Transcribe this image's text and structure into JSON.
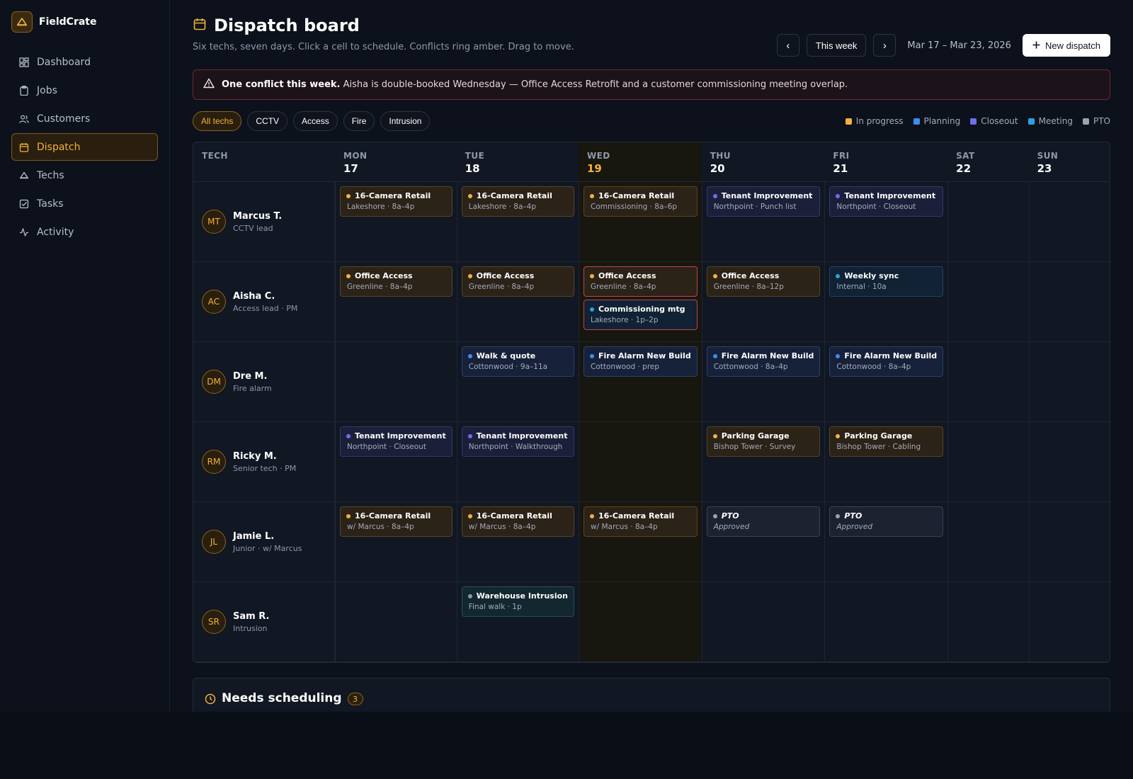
{
  "brand": {
    "name": "FieldCrate"
  },
  "nav": [
    {
      "label": "Dashboard",
      "icon": "dashboard-icon",
      "active": false
    },
    {
      "label": "Jobs",
      "icon": "clipboard-icon",
      "active": false
    },
    {
      "label": "Customers",
      "icon": "users-icon",
      "active": false
    },
    {
      "label": "Dispatch",
      "icon": "calendar-icon",
      "active": true
    },
    {
      "label": "Techs",
      "icon": "hardhat-icon",
      "active": false
    },
    {
      "label": "Tasks",
      "icon": "checkbox-icon",
      "active": false
    },
    {
      "label": "Activity",
      "icon": "activity-icon",
      "active": false
    }
  ],
  "header": {
    "title": "Dispatch board",
    "subtitle": "Six techs, seven days. Click a cell to schedule. Conflicts ring amber. Drag to move.",
    "prev": "‹",
    "this_week": "This week",
    "next": "›",
    "date_range": "Mar 17 – Mar 23, 2026",
    "new_dispatch": "New dispatch"
  },
  "alert": {
    "strong": "One conflict this week.",
    "text": " Aisha is double-booked Wednesday — Office Access Retrofit and a customer commissioning meeting overlap."
  },
  "filters": [
    "All techs",
    "CCTV",
    "Access",
    "Fire",
    "Intrusion"
  ],
  "legend": [
    {
      "label": "In progress",
      "color": "#f3b23a"
    },
    {
      "label": "Planning",
      "color": "#3b8ef0"
    },
    {
      "label": "Closeout",
      "color": "#6e6ef0"
    },
    {
      "label": "Meeting",
      "color": "#29a3e0"
    },
    {
      "label": "PTO",
      "color": "#9aa3b2"
    }
  ],
  "board": {
    "tech_header": "TECH",
    "days": [
      {
        "dow": "MON",
        "num": "17"
      },
      {
        "dow": "TUE",
        "num": "18"
      },
      {
        "dow": "WED",
        "num": "19",
        "today": true
      },
      {
        "dow": "THU",
        "num": "20"
      },
      {
        "dow": "FRI",
        "num": "21"
      },
      {
        "dow": "SAT",
        "num": "22"
      },
      {
        "dow": "SUN",
        "num": "23"
      }
    ],
    "techs": [
      {
        "initials": "MT",
        "name": "Marcus T.",
        "role": "CCTV lead",
        "days": [
          [
            {
              "title": "16-Camera Retail",
              "sub": "Lakeshore · 8a–4p",
              "type": "progress"
            }
          ],
          [
            {
              "title": "16-Camera Retail",
              "sub": "Lakeshore · 8a–4p",
              "type": "progress"
            }
          ],
          [
            {
              "title": "16-Camera Retail",
              "sub": "Commissioning · 8a–6p",
              "type": "progress"
            }
          ],
          [
            {
              "title": "Tenant Improvement",
              "sub": "Northpoint · Punch list",
              "type": "closeout"
            }
          ],
          [
            {
              "title": "Tenant Improvement",
              "sub": "Northpoint · Closeout",
              "type": "closeout"
            }
          ],
          [],
          []
        ]
      },
      {
        "initials": "AC",
        "name": "Aisha C.",
        "role": "Access lead · PM",
        "days": [
          [
            {
              "title": "Office Access",
              "sub": "Greenline · 8a–4p",
              "type": "progress"
            }
          ],
          [
            {
              "title": "Office Access",
              "sub": "Greenline · 8a–4p",
              "type": "progress"
            }
          ],
          [
            {
              "title": "Office Access",
              "sub": "Greenline · 8a–4p",
              "type": "progress",
              "conflict": true
            },
            {
              "title": "Commissioning mtg",
              "sub": "Lakeshore · 1p–2p",
              "type": "meeting",
              "conflict": true
            }
          ],
          [
            {
              "title": "Office Access",
              "sub": "Greenline · 8a–12p",
              "type": "progress"
            }
          ],
          [
            {
              "title": "Weekly sync",
              "sub": "Internal · 10a",
              "type": "meeting"
            }
          ],
          [],
          []
        ]
      },
      {
        "initials": "DM",
        "name": "Dre M.",
        "role": "Fire alarm",
        "days": [
          [],
          [
            {
              "title": "Walk & quote",
              "sub": "Cottonwood · 9a–11a",
              "type": "planning"
            }
          ],
          [
            {
              "title": "Fire Alarm New Build",
              "sub": "Cottonwood · prep",
              "type": "planning"
            }
          ],
          [
            {
              "title": "Fire Alarm New Build",
              "sub": "Cottonwood · 8a–4p",
              "type": "planning"
            }
          ],
          [
            {
              "title": "Fire Alarm New Build",
              "sub": "Cottonwood · 8a–4p",
              "type": "planning"
            }
          ],
          [],
          []
        ]
      },
      {
        "initials": "RM",
        "name": "Ricky M.",
        "role": "Senior tech · PM",
        "days": [
          [
            {
              "title": "Tenant Improvement",
              "sub": "Northpoint · Closeout",
              "type": "closeout"
            }
          ],
          [
            {
              "title": "Tenant Improvement",
              "sub": "Northpoint · Walkthrough",
              "type": "closeout"
            }
          ],
          [],
          [
            {
              "title": "Parking Garage",
              "sub": "Bishop Tower · Survey",
              "type": "progress"
            }
          ],
          [
            {
              "title": "Parking Garage",
              "sub": "Bishop Tower · Cabling",
              "type": "progress"
            }
          ],
          [],
          []
        ]
      },
      {
        "initials": "JL",
        "name": "Jamie L.",
        "role": "Junior · w/ Marcus",
        "days": [
          [
            {
              "title": "16-Camera Retail",
              "sub": "w/ Marcus · 8a–4p",
              "type": "progress"
            }
          ],
          [
            {
              "title": "16-Camera Retail",
              "sub": "w/ Marcus · 8a–4p",
              "type": "progress"
            }
          ],
          [
            {
              "title": "16-Camera Retail",
              "sub": "w/ Marcus · 8a–4p",
              "type": "progress"
            }
          ],
          [
            {
              "title": "PTO",
              "sub": "Approved",
              "type": "pto"
            }
          ],
          [
            {
              "title": "PTO",
              "sub": "Approved",
              "type": "pto"
            }
          ],
          [],
          []
        ]
      },
      {
        "initials": "SR",
        "name": "Sam R.",
        "role": "Intrusion",
        "days": [
          [],
          [
            {
              "title": "Warehouse Intrusion",
              "sub": "Final walk · 1p",
              "type": "intrusion"
            }
          ],
          [],
          [],
          [],
          [],
          []
        ]
      }
    ]
  },
  "needs": {
    "title": "Needs scheduling",
    "count": "3"
  }
}
